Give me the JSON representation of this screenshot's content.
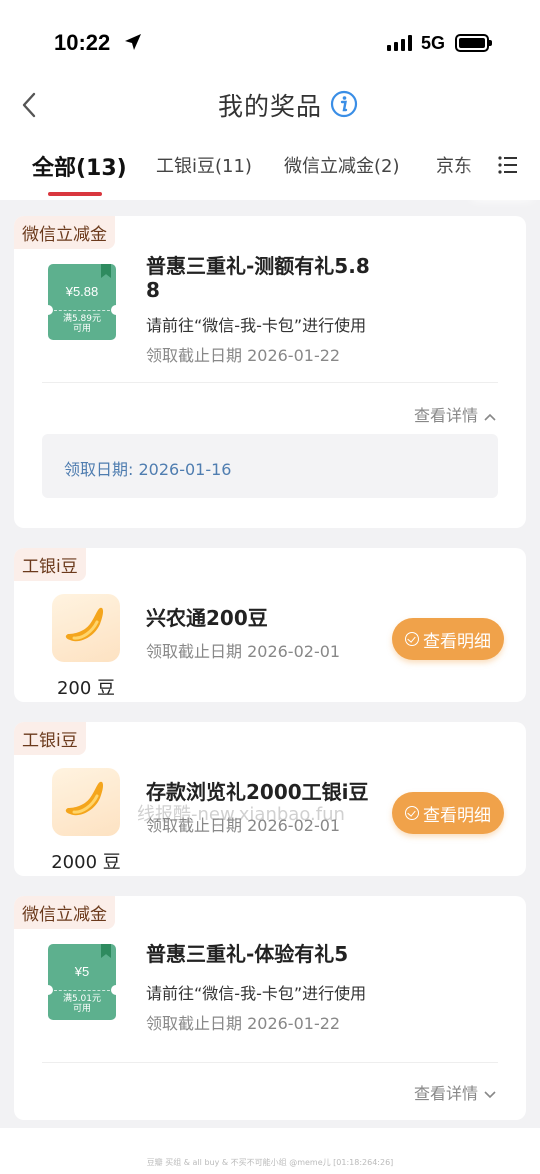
{
  "status": {
    "time": "10:22",
    "network": "5G"
  },
  "nav": {
    "title": "我的奖品"
  },
  "tabs": [
    {
      "label": "全部(13)"
    },
    {
      "label": "工银i豆(11)"
    },
    {
      "label": "微信立减金(2)"
    },
    {
      "label": "京东"
    }
  ],
  "cards": [
    {
      "tag": "微信立减金",
      "coupon_amount": "¥5.88",
      "coupon_condition_1": "满5.89元",
      "coupon_condition_2": "可用",
      "title_line1": "普惠三重礼-测额有礼5.8",
      "title_line2": "8",
      "desc": "请前往“微信-我-卡包”进行使用",
      "expire": "领取截止日期 2026-01-22",
      "detail_label": "查看详情",
      "receive_date": "领取日期: 2026-01-16"
    },
    {
      "tag": "工银i豆",
      "quantity": "200 豆",
      "title": "兴农通200豆",
      "expire": "领取截止日期 2026-02-01",
      "button": "查看明细"
    },
    {
      "tag": "工银i豆",
      "quantity": "2000 豆",
      "title": "存款浏览礼2000工银i豆",
      "expire": "领取截止日期 2026-02-01",
      "button": "查看明细"
    },
    {
      "tag": "微信立减金",
      "coupon_amount": "¥5",
      "coupon_condition_1": "满5.01元",
      "coupon_condition_2": "可用",
      "title": "普惠三重礼-体验有礼5",
      "desc": "请前往“微信-我-卡包”进行使用",
      "expire": "领取截止日期 2026-01-22",
      "detail_label": "查看详情"
    }
  ],
  "watermark": "线报酷-new.xianbao.fun",
  "footer": "豆瓣 买组 & all buy & 不买不可能小组 @meme儿 [01:18:264:26]",
  "colors": {
    "accent_red": "#d9363e",
    "button_orange": "#f0a24a",
    "coupon_green": "#5db08e",
    "link_blue": "#4f7db0"
  }
}
